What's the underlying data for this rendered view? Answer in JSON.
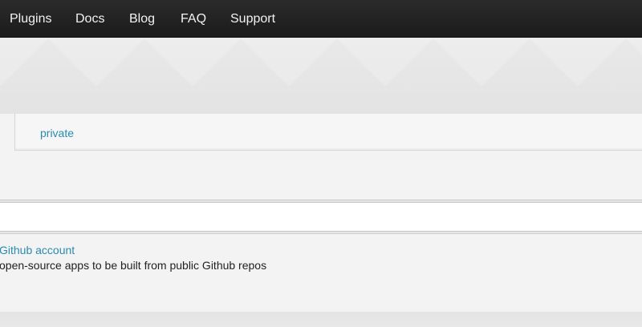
{
  "nav": {
    "items": [
      {
        "label": "Plugins"
      },
      {
        "label": "Docs"
      },
      {
        "label": "Blog"
      },
      {
        "label": "FAQ"
      },
      {
        "label": "Support"
      }
    ]
  },
  "tabs": {
    "private_label": "private"
  },
  "repo_input": {
    "value": ""
  },
  "info": {
    "link_text": "Github account",
    "description": "open-source apps to be built from public Github repos"
  },
  "colors": {
    "topbar": "#1f1f1f",
    "link": "#2a8bb0",
    "text": "#222222",
    "panel": "#f3f3f3"
  }
}
